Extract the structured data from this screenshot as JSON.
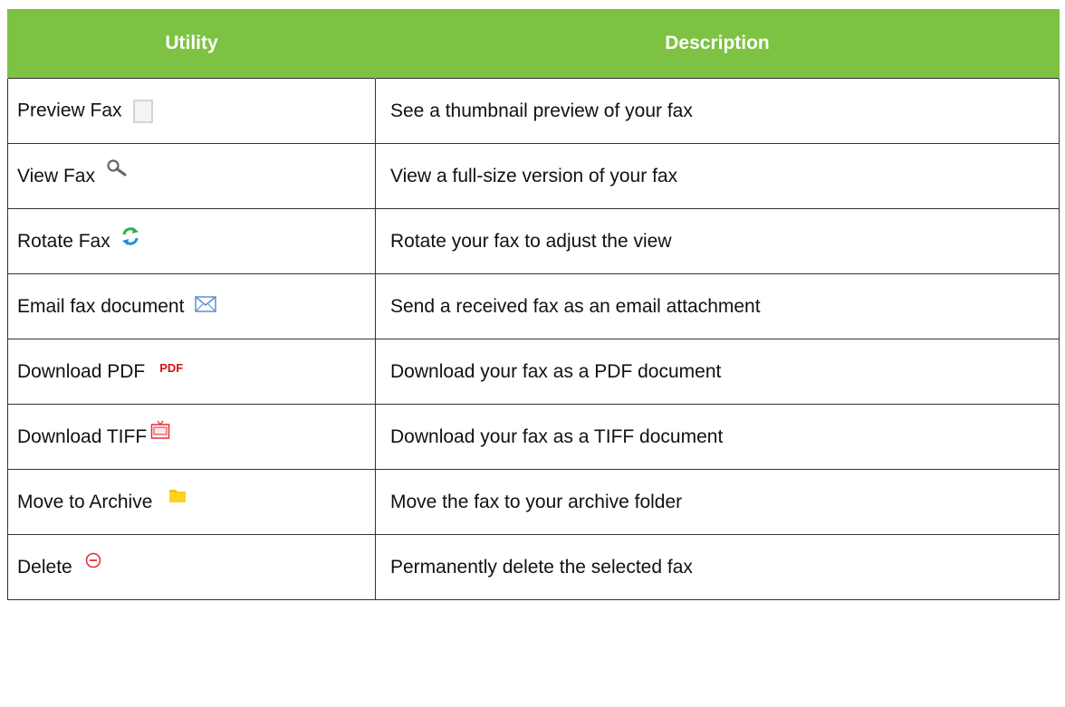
{
  "header": {
    "utility": "Utility",
    "description": "Description"
  },
  "rows": [
    {
      "utility": "Preview Fax",
      "icon": "preview-icon",
      "description": "See a thumbnail preview of your fax"
    },
    {
      "utility": "View Fax",
      "icon": "magnifier-icon",
      "description": "View a full-size version of your fax"
    },
    {
      "utility": "Rotate Fax",
      "icon": "rotate-icon",
      "description": "Rotate your fax to adjust the view"
    },
    {
      "utility": "Email fax document",
      "icon": "envelope-icon",
      "description": "Send a received fax as an email attachment"
    },
    {
      "utility": "Download PDF",
      "icon": "pdf-icon",
      "icon_text": "PDF",
      "description": "Download your fax as a PDF document"
    },
    {
      "utility": "Download TIFF",
      "icon": "tiff-icon",
      "description": "Download your fax as a TIFF document"
    },
    {
      "utility": "Move to Archive",
      "icon": "folder-icon",
      "description": "Move the fax to your archive folder"
    },
    {
      "utility": "Delete",
      "icon": "delete-icon",
      "description": "Permanently delete the selected fax"
    }
  ],
  "colors": {
    "header_bg": "#7dc242",
    "header_text": "#ffffff",
    "pdf_red": "#d0121b",
    "folder_yellow": "#f5c400",
    "rotate_green": "#2ab24a",
    "rotate_blue": "#1c8fd6",
    "envelope_blue": "#5b8fd0",
    "delete_red": "#e0303a"
  }
}
